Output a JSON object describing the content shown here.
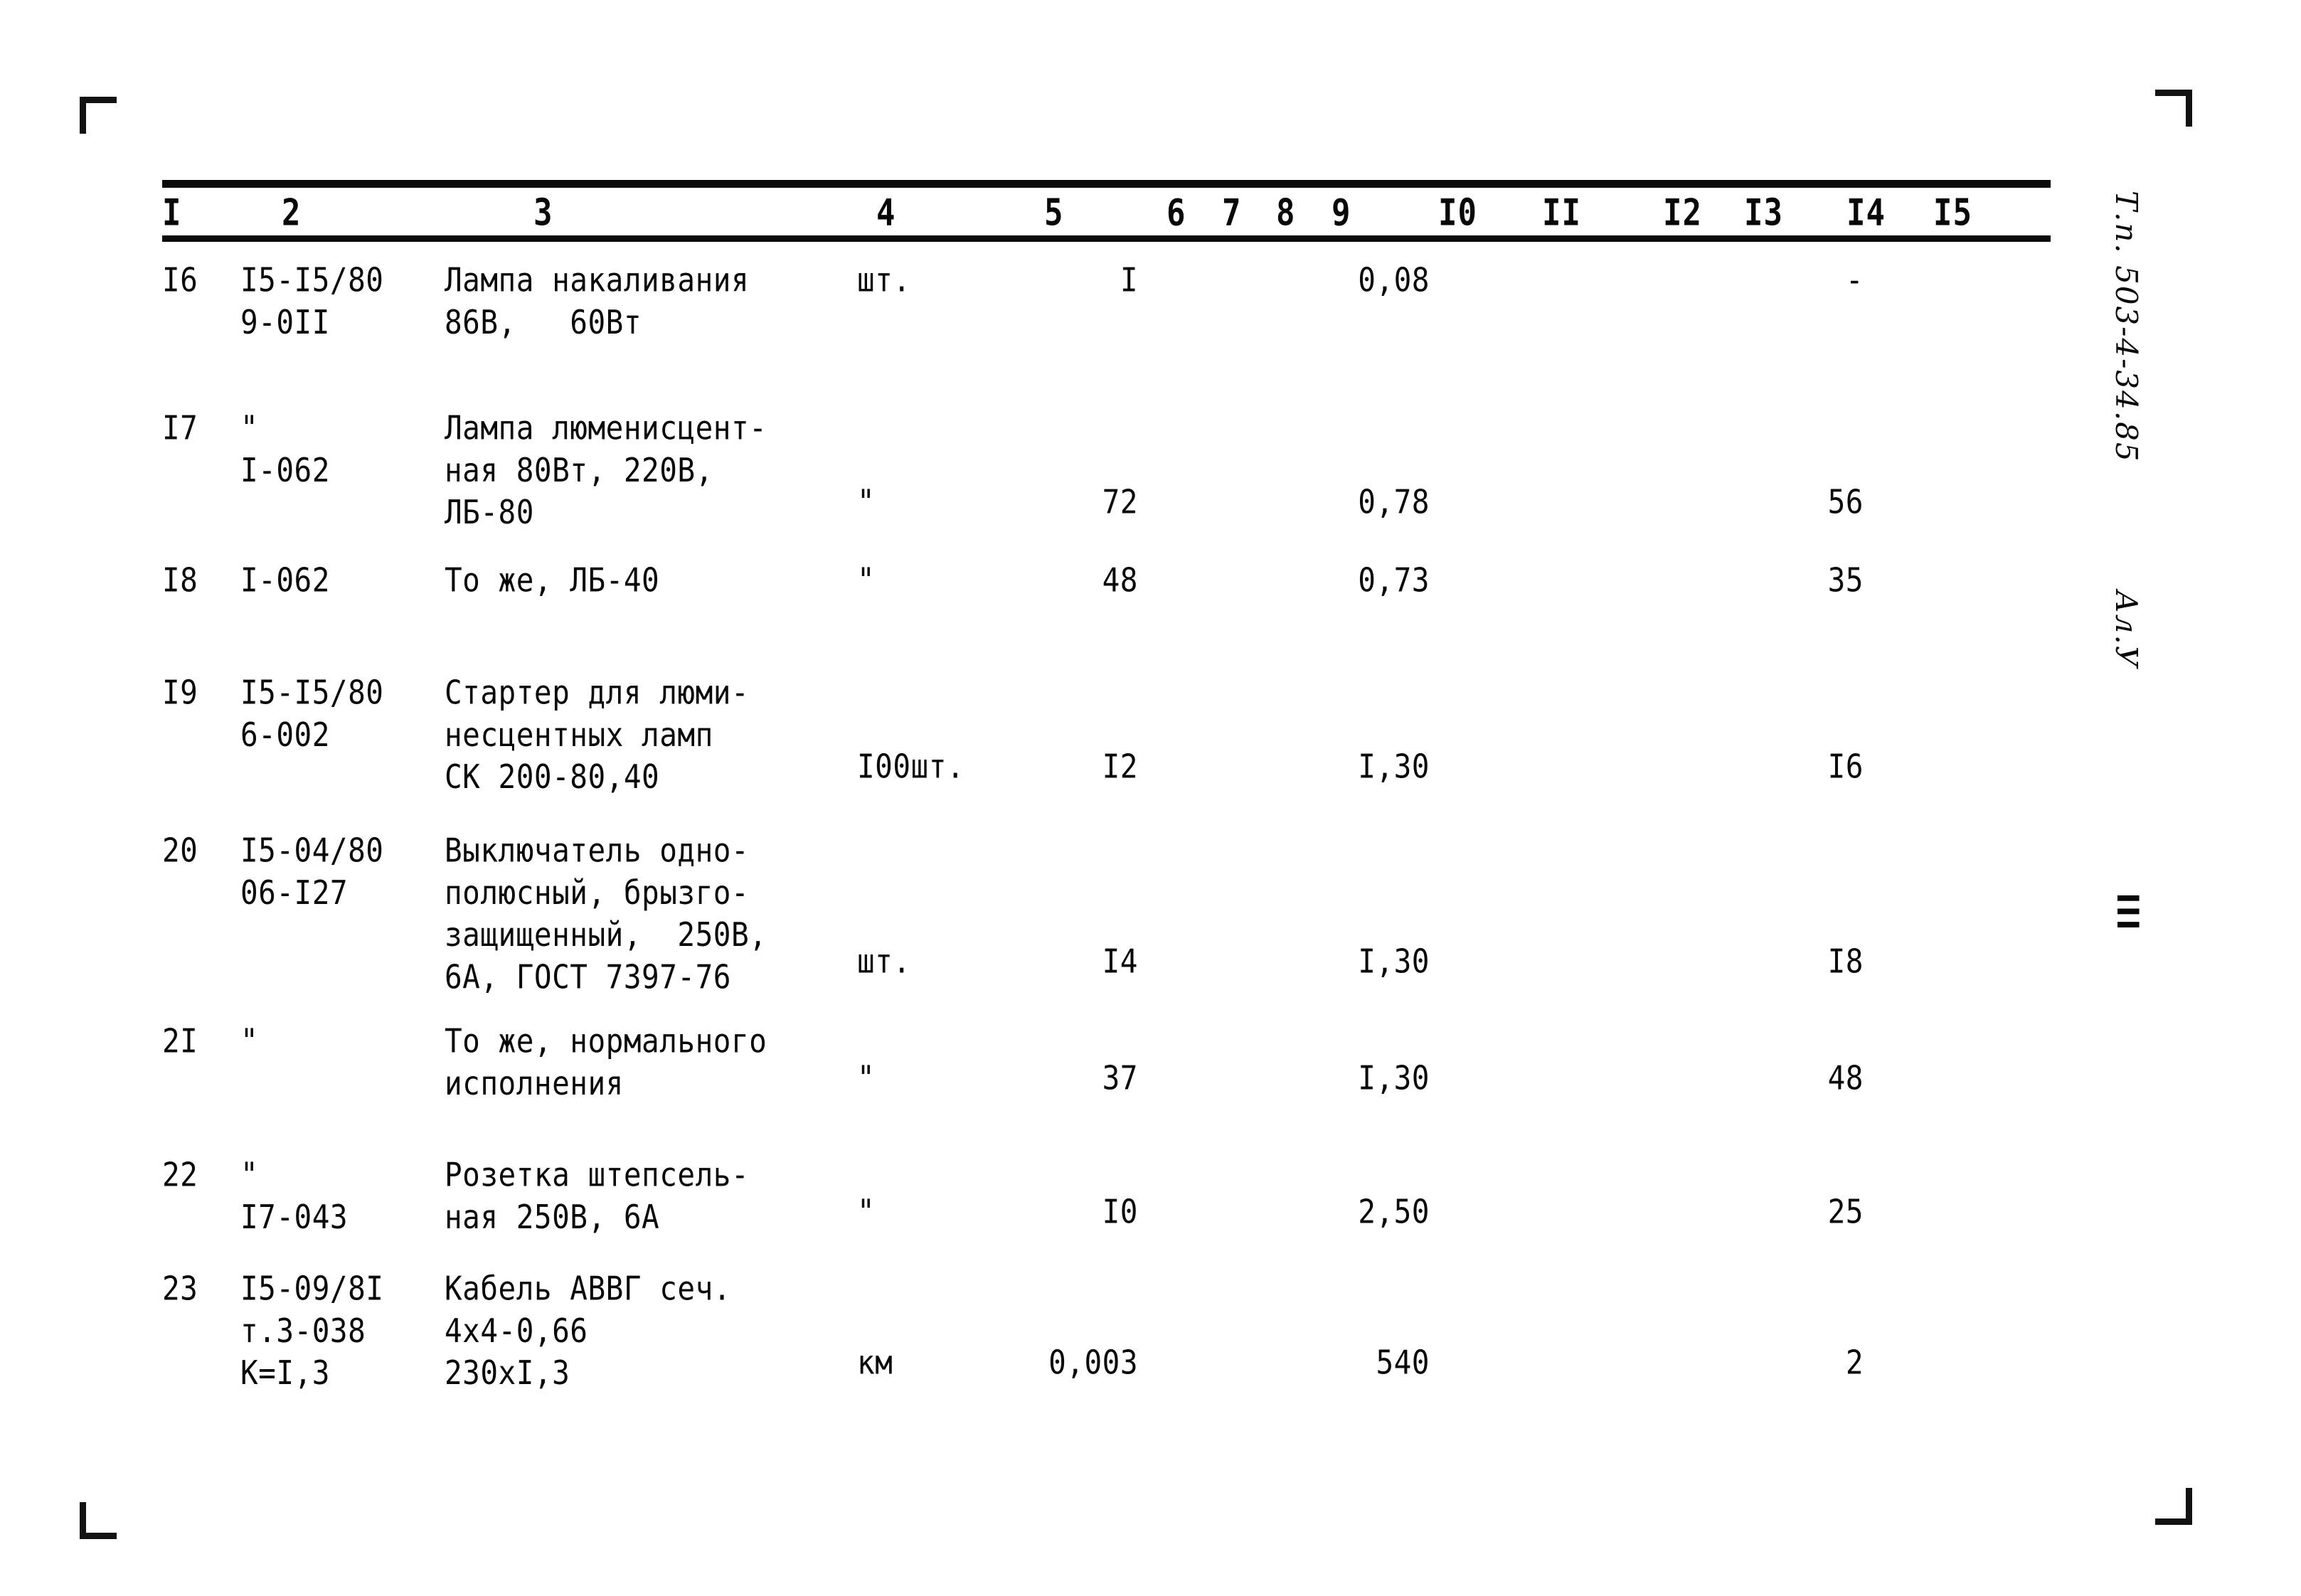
{
  "page": {
    "background_color": "#ffffff",
    "ink_color": "#141414"
  },
  "margin_stamps": {
    "series_code": "Т.п. 503-4-34.85",
    "sheet_code": "Ал.У",
    "section_marker": "III"
  },
  "table": {
    "column_headers": [
      "I",
      "2",
      "3",
      "4",
      "5",
      "6",
      "7",
      "8",
      "9",
      "I0",
      "II",
      "I2",
      "I3",
      "I4",
      "I5"
    ],
    "rows": [
      {
        "num": "I6",
        "code": "I5-I5/80\n9-0II",
        "name": "Лампа накаливания\n86В,   60Вт",
        "unit": "шт.",
        "qty": "I",
        "price": "0,08",
        "total": "-"
      },
      {
        "num": "I7",
        "code": "\"\nI-062",
        "name": "Лампа люменисцент-\nная 80Вт, 220В,\nЛБ-80",
        "unit": "\"",
        "qty": "72",
        "price": "0,78",
        "total": "56"
      },
      {
        "num": "I8",
        "code": "I-062",
        "name": "То же, ЛБ-40",
        "unit": "\"",
        "qty": "48",
        "price": "0,73",
        "total": "35"
      },
      {
        "num": "I9",
        "code": "I5-I5/80\n6-002",
        "name": "Стартер для люми-\nнесцентных ламп\nСК 200-80,40",
        "unit": "I00шт.",
        "qty": "I2",
        "price": "I,30",
        "total": "I6"
      },
      {
        "num": "20",
        "code": "I5-04/80\n06-I27",
        "name": "Выключатель одно-\nполюсный, брызго-\nзащищенный,  250В,\n6А, ГОСТ 7397-76",
        "unit": "шт.",
        "qty": "I4",
        "price": "I,30",
        "total": "I8"
      },
      {
        "num": "2I",
        "code": "\"",
        "name": "То же, нормального\nисполнения",
        "unit": "\"",
        "qty": "37",
        "price": "I,30",
        "total": "48"
      },
      {
        "num": "22",
        "code": "\"\nI7-043",
        "name": "Розетка штепсель-\nная 250В, 6А",
        "unit": "\"",
        "qty": "I0",
        "price": "2,50",
        "total": "25"
      },
      {
        "num": "23",
        "code": "I5-09/8I\nт.3-038\nК=I,3",
        "name": "Кабель АВВГ сеч.\n4х4-0,66\n230хI,3",
        "unit": "км",
        "qty": "0,003",
        "price": "540",
        "total": "2"
      }
    ]
  }
}
